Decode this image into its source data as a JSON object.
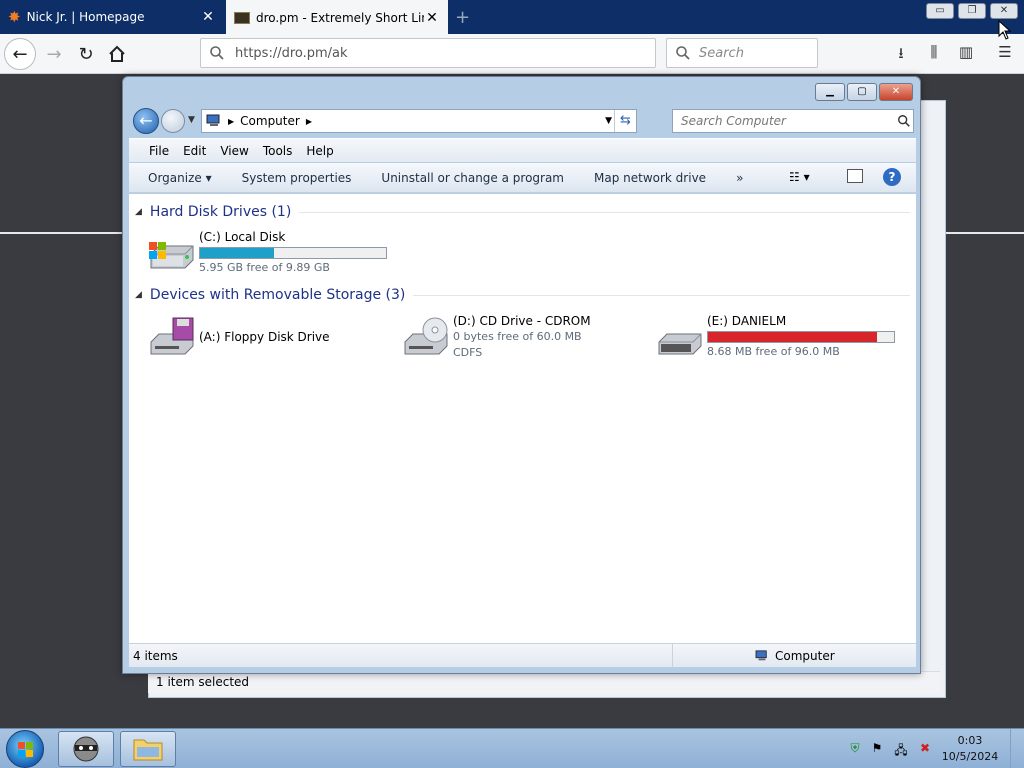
{
  "browser": {
    "tabs": [
      {
        "title": "Nick Jr. | Homepage",
        "icon": "nick-jr-icon"
      },
      {
        "title": "dro.pm - Extremely Short Links",
        "icon": "dro-pm-icon"
      }
    ],
    "close_glyph": "✕",
    "new_tab_glyph": "+",
    "url": "https://dro.pm/ak",
    "search_placeholder": "Search",
    "window_controls": {
      "minimize": "▭",
      "restore": "❐",
      "close": "✕"
    }
  },
  "explorer": {
    "title_controls": {
      "minimize": "▁",
      "maximize": "▢",
      "close": "✕"
    },
    "address": {
      "crumb": "Computer"
    },
    "search_placeholder": "Search Computer",
    "menu": [
      "File",
      "Edit",
      "View",
      "Tools",
      "Help"
    ],
    "commands": [
      "Organize ▾",
      "System properties",
      "Uninstall or change a program",
      "Map network drive",
      "»"
    ],
    "groups": [
      {
        "title": "Hard Disk Drives (1)",
        "drives": [
          {
            "name": "(C:) Local Disk",
            "free_text": "5.95 GB free of 9.89 GB",
            "used_fraction": 0.398,
            "bar_color": "#1fa0c8",
            "icon": "hard-disk-icon"
          }
        ]
      },
      {
        "title": "Devices with Removable Storage (3)",
        "drives": [
          {
            "name": "(A:) Floppy Disk Drive",
            "icon": "floppy-drive-icon"
          },
          {
            "name": "(D:) CD Drive - CDROM",
            "free_text": "0 bytes free of 60.0 MB",
            "filesystem": "CDFS",
            "icon": "cd-drive-icon"
          },
          {
            "name": "(E:) DANIELM",
            "free_text": "8.68 MB free of 96.0 MB",
            "used_fraction": 0.91,
            "bar_color": "#d8242b",
            "icon": "usb-drive-icon"
          }
        ]
      }
    ],
    "status": {
      "items": "4 items",
      "location": "Computer"
    }
  },
  "background_window": {
    "status": "1 item selected"
  },
  "taskbar": {
    "time": "0:03",
    "date": "10/5/2024"
  }
}
